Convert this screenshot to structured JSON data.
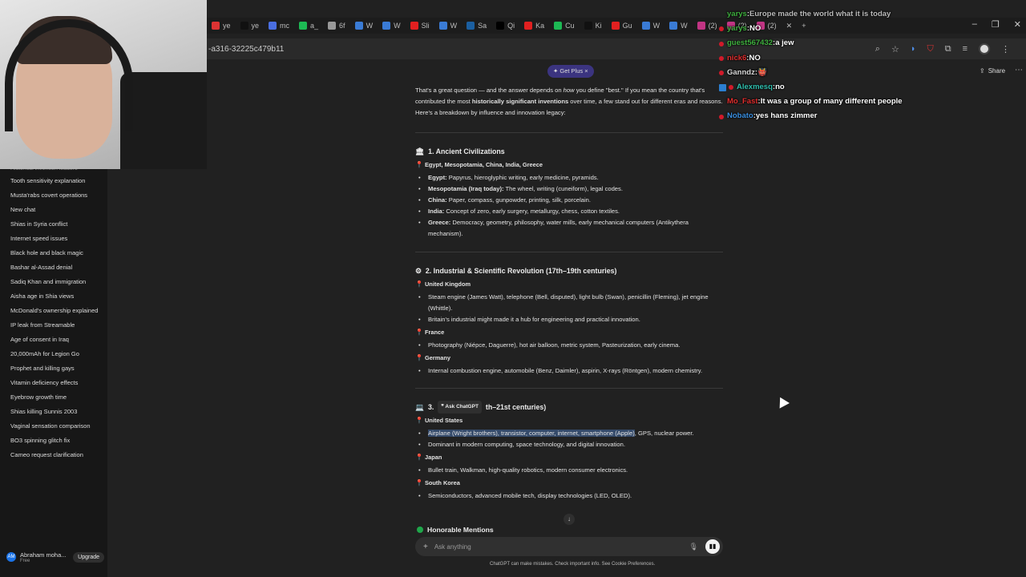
{
  "browser": {
    "tabs": [
      {
        "label": "ye",
        "color": "#d33"
      },
      {
        "label": "ye",
        "color": "#111"
      },
      {
        "label": "mc",
        "color": "#4a6ee0"
      },
      {
        "label": "a_",
        "color": "#1db954"
      },
      {
        "label": "6f",
        "color": "#999"
      },
      {
        "label": "W",
        "color": "#3a7bd5"
      },
      {
        "label": "W",
        "color": "#3a7bd5"
      },
      {
        "label": "Sli",
        "color": "#e02020"
      },
      {
        "label": "W",
        "color": "#3a7bd5"
      },
      {
        "label": "Sa",
        "color": "#1b5fa0"
      },
      {
        "label": "Qi",
        "color": "#000"
      },
      {
        "label": "Ka",
        "color": "#e02020"
      },
      {
        "label": "Cu",
        "color": "#1db954"
      },
      {
        "label": "Ki",
        "color": "#111"
      },
      {
        "label": "Gu",
        "color": "#e02020"
      },
      {
        "label": "W",
        "color": "#3a7bd5"
      },
      {
        "label": "W",
        "color": "#3a7bd5"
      },
      {
        "label": "(2)",
        "color": "#c13584"
      },
      {
        "label": "(2)",
        "color": "#c13584"
      },
      {
        "label": "(2)",
        "color": "#c13584"
      }
    ],
    "window_controls": [
      "–",
      "❐",
      "✕"
    ],
    "url_fragment": "-a316-32225c479b11"
  },
  "header": {
    "get_plus": "✦ Get Plus ×",
    "share": "Share",
    "more": "⋯"
  },
  "sidebar": {
    "cut_item": "Historical invention leaders",
    "items": [
      "Tooth sensitivity explanation",
      "Musta'rabs covert operations",
      "New chat",
      "Shias in Syria conflict",
      "Internet speed issues",
      "Black hole and black magic",
      "Bashar al-Assad denial",
      "Sadiq Khan and immigration",
      "Aisha age in Shia views",
      "McDonald's ownership explained",
      "IP leak from Streamable",
      "Age of consent in Iraq",
      "20,000mAh for Legion Go",
      "Prophet and killing gays",
      "Vitamin deficiency effects",
      "Eyebrow growth time",
      "Shias killing Sunnis 2003",
      "Vaginal sensation comparison",
      "BO3 spinning glitch fix",
      "Cameo request clarification"
    ],
    "user": {
      "initials": "AM",
      "name": "Abraham moha...",
      "plan": "Free",
      "upgrade": "Upgrade"
    }
  },
  "content": {
    "intro_a": "That's a great question — and the answer depends on ",
    "intro_em": "how",
    "intro_b": " you define \"best.\" If you mean the country that's contributed the most ",
    "intro_strong": "historically significant inventions",
    "intro_c": " over time, a few stand out for different eras and reasons. Here's a breakdown by influence and innovation legacy:",
    "s1_title": "1. Ancient Civilizations",
    "s1_sub": "Egypt, Mesopotamia, China, India, Greece",
    "s1_items": [
      {
        "k": "Egypt:",
        "v": " Papyrus, hieroglyphic writing, early medicine, pyramids."
      },
      {
        "k": "Mesopotamia (Iraq today):",
        "v": " The wheel, writing (cuneiform), legal codes."
      },
      {
        "k": "China:",
        "v": " Paper, compass, gunpowder, printing, silk, porcelain."
      },
      {
        "k": "India:",
        "v": " Concept of zero, early surgery, metallurgy, chess, cotton textiles."
      },
      {
        "k": "Greece:",
        "v": " Democracy, geometry, philosophy, water mills, early mechanical computers (Antikythera mechanism)."
      }
    ],
    "s2_title": "2. Industrial & Scientific Revolution (17th–19th centuries)",
    "s2_uk": "United Kingdom",
    "s2_uk_items": [
      "Steam engine (James Watt), telephone (Bell, disputed), light bulb (Swan), penicillin (Fleming), jet engine (Whittle).",
      "Britain's industrial might made it a hub for engineering and practical innovation."
    ],
    "s2_fr": "France",
    "s2_fr_items": [
      "Photography (Niépce, Daguerre), hot air balloon, metric system, Pasteurization, early cinema."
    ],
    "s2_de": "Germany",
    "s2_de_items": [
      "Internal combustion engine, automobile (Benz, Daimler), aspirin, X-rays (Röntgen), modern chemistry."
    ],
    "s3_num": "3.",
    "s3_ask": "❞ Ask ChatGPT",
    "s3_rest": "th–21st centuries)",
    "s3_us": "United States",
    "s3_us_hl": "Airplane (Wright brothers), transistor, computer, internet, smartphone (Apple)",
    "s3_us_rest": ", GPS, nuclear power.",
    "s3_us_2": "Dominant in modern computing, space technology, and digital innovation.",
    "s3_jp": "Japan",
    "s3_jp_items": [
      "Bullet train, Walkman, high-quality robotics, modern consumer electronics."
    ],
    "s3_kr": "South Korea",
    "s3_kr_items": [
      "Semiconductors, advanced mobile tech, display technologies (LED, OLED)."
    ],
    "honorable": "Honorable Mentions"
  },
  "composer": {
    "placeholder": "Ask anything",
    "disclaimer": "ChatGPT can make mistakes. Check important info. See Cookie Preferences."
  },
  "chat": [
    {
      "user": "yarys",
      "color": "#3fb03f",
      "msg": "Europe made the world what it is today",
      "badge": false
    },
    {
      "user": "yarys",
      "color": "#3fb03f",
      "msg": "NO",
      "badge": true
    },
    {
      "user": "guest567432",
      "color": "#3fb03f",
      "msg": "a jew",
      "badge": true
    },
    {
      "user": "nick6",
      "color": "#e02d2d",
      "msg": "NO",
      "badge": true
    },
    {
      "user": "Ganndz",
      "color": "#d7d7d7",
      "msg": "👹",
      "badge": true
    },
    {
      "user": "Alexmesq",
      "color": "#2fbfae",
      "msg": "no",
      "badge": true,
      "sbadge": true
    },
    {
      "user": "Mo_Fast",
      "color": "#e02d2d",
      "msg": "It was a group of many different people",
      "badge": false
    },
    {
      "user": "Nobato",
      "color": "#3a8fe0",
      "msg": "yes hans zimmer",
      "badge": true
    }
  ]
}
